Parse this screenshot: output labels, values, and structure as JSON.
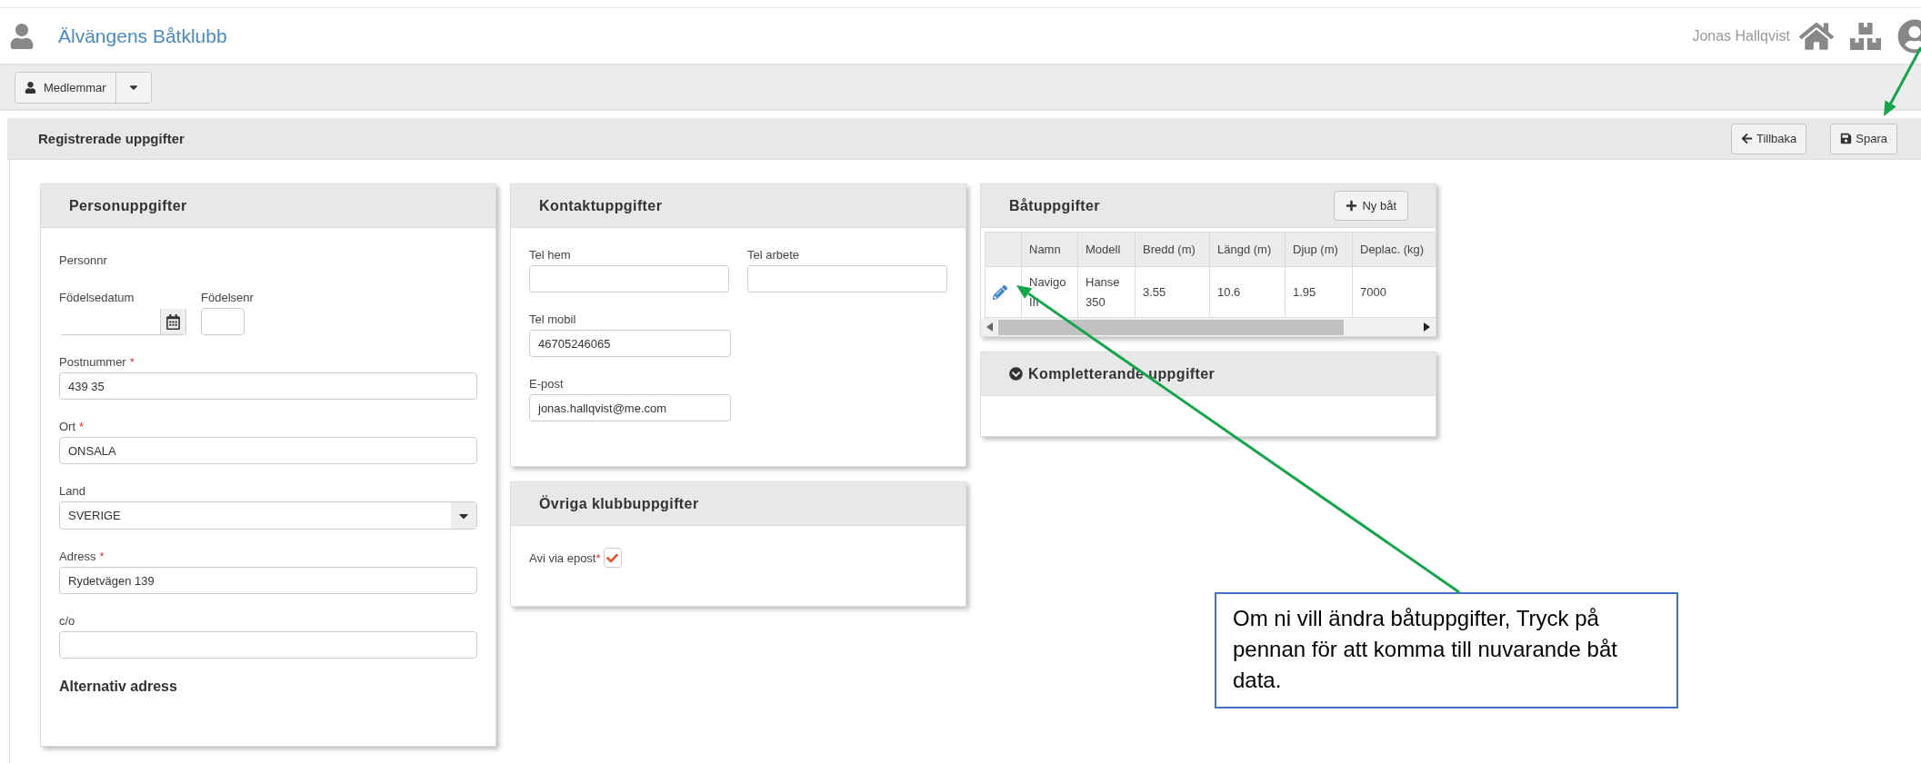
{
  "app": {
    "title": "Älvängens Båtklubb",
    "user": "Jonas Hallqvist"
  },
  "toolbar": {
    "module_button": "Medlemmar"
  },
  "page": {
    "title": "Registrerade uppgifter",
    "buttons": [
      {
        "label": "Tillbaka",
        "kind": "back"
      },
      {
        "label": "Spara",
        "kind": "save"
      }
    ]
  },
  "person_card": {
    "title": "Personuppgifter",
    "personnr_label": "Personnr",
    "birth_date_label": "Födelsedatum",
    "birth_number_label": "Födelsenr",
    "fields": [
      {
        "label": "Postnummer",
        "mark": "*",
        "value": "439 35",
        "kind": "text"
      },
      {
        "label": "Ort",
        "mark": "*",
        "value": "ONSALA",
        "kind": "text"
      },
      {
        "label": "Land",
        "value": "SVERIGE",
        "kind": "select"
      },
      {
        "label": "Adress",
        "mark": "*",
        "value": "Rydetvägen 139",
        "kind": "text"
      },
      {
        "label": "c/o",
        "kind": "text"
      }
    ],
    "subheading": "Alternativ adress"
  },
  "contact_card": {
    "title": "Kontaktuppgifter",
    "rows": [
      [
        {
          "label": "Tel hem"
        },
        {
          "label": "Tel arbete"
        }
      ],
      [
        {
          "label": "Tel mobil",
          "value": "46705246065"
        }
      ],
      [
        {
          "label": "E-post",
          "value": "jonas.hallqvist@me.com"
        }
      ]
    ]
  },
  "club_card": {
    "title": "Övriga klubbuppgifter",
    "checkbox": {
      "label": "Avi via epost",
      "mark": "*",
      "checked": true
    }
  },
  "boat_card": {
    "title": "Båtuppgifter",
    "new_button": "Ny båt",
    "table": {
      "columns": [
        "Namn",
        "Modell",
        "Bredd (m)",
        "Längd (m)",
        "Djup (m)",
        "Deplac. (kg)"
      ],
      "rows": [
        {
          "cells": [
            "Navigo III",
            "Hanse 350",
            "3.55",
            "10.6",
            "1.95",
            "7000"
          ]
        }
      ]
    }
  },
  "extra_card": {
    "title": "Kompletterande uppgifter",
    "expanded": false
  },
  "annotation": {
    "text": "Om ni vill ändra båtuppgifter, Tryck på pennan för att komma till nuvarande båt data."
  }
}
